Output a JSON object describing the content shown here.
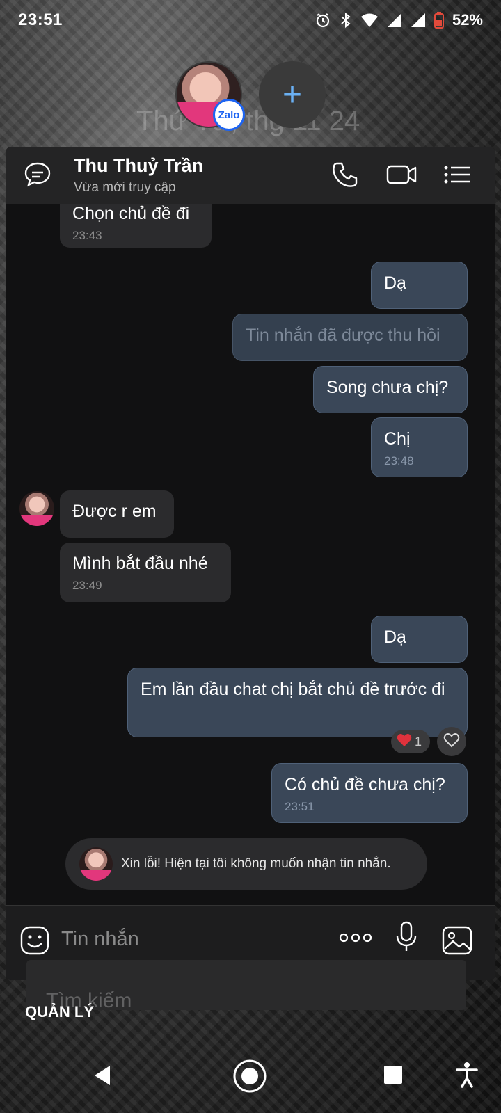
{
  "status_bar": {
    "time": "23:51",
    "battery": "52%",
    "icons": [
      "alarm-icon",
      "bluetooth-icon",
      "wifi-icon",
      "signal-icon",
      "signal-icon",
      "battery-icon"
    ]
  },
  "bubbles": {
    "faded_date": "Thứ Tư, thg 11 24",
    "badge": "Zalo",
    "add_label": "+"
  },
  "chat": {
    "contact_name": "Thu Thuỷ Trần",
    "status": "Vừa mới truy cập",
    "messages": [
      {
        "dir": "in",
        "text": "Chọn chủ đề đi",
        "time": "23:43"
      },
      {
        "dir": "out",
        "text": "Dạ",
        "time": ""
      },
      {
        "dir": "out",
        "text": "Tin nhắn đã được thu hồi",
        "time": "",
        "recalled": true
      },
      {
        "dir": "out",
        "text": "Song chưa chị?",
        "time": ""
      },
      {
        "dir": "out",
        "text": "Chị",
        "time": "23:48"
      },
      {
        "dir": "in",
        "text": "Được r em",
        "time": ""
      },
      {
        "dir": "in",
        "text": "Mình bắt đầu nhé",
        "time": "23:49"
      },
      {
        "dir": "out",
        "text": "Dạ",
        "time": ""
      },
      {
        "dir": "out",
        "text": "Em lần đầu chat chị bắt chủ đề trước đi",
        "time": ""
      },
      {
        "dir": "out",
        "text": "Có chủ đề chưa chị?",
        "time": "23:51"
      }
    ],
    "reaction_count": "1",
    "notice": "Xin lỗi! Hiện tại tôi không muốn nhận tin nhắn.",
    "input_placeholder": "Tin nhắn"
  },
  "behind": {
    "search_text": "Tìm kiếm",
    "manage_label": "QUẢN LÝ"
  },
  "colors": {
    "accent_blue": "#6ab0f3",
    "out_bubble": "#3a4758",
    "in_bubble": "#2b2b2d",
    "avatar_shirt": "#e2377c"
  }
}
